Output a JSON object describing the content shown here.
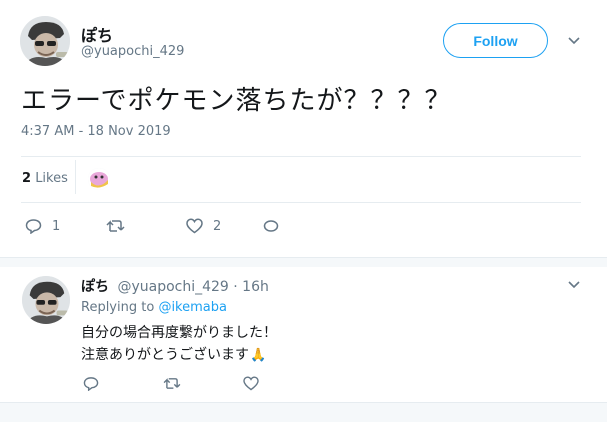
{
  "colors": {
    "accent": "#1da1f2",
    "text": "#14171a",
    "muted": "#657786",
    "divider": "#e6ecf0"
  },
  "tweet": {
    "author_name": "ぽち",
    "author_handle": "@yuapochi_429",
    "follow_label": "Follow",
    "text": "エラーでポケモン落ちたが？？？？",
    "timestamp": "4:37 AM - 18 Nov 2019",
    "likes_count": "2",
    "likes_label": "Likes",
    "actions": {
      "reply_count": "1",
      "retweet_count": "",
      "like_count": "2"
    }
  },
  "reply": {
    "author_name": "ぽち",
    "author_handle": "@yuapochi_429",
    "time": "· 16h",
    "replying_label": "Replying to",
    "replying_to": "@ikemaba",
    "line1": "自分の場合再度繋がりました！",
    "line2": "注意ありがとうございます",
    "emoji": "🙏"
  },
  "icons": [
    "chevron-down-icon",
    "reply-icon",
    "retweet-icon",
    "heart-icon",
    "message-icon"
  ]
}
